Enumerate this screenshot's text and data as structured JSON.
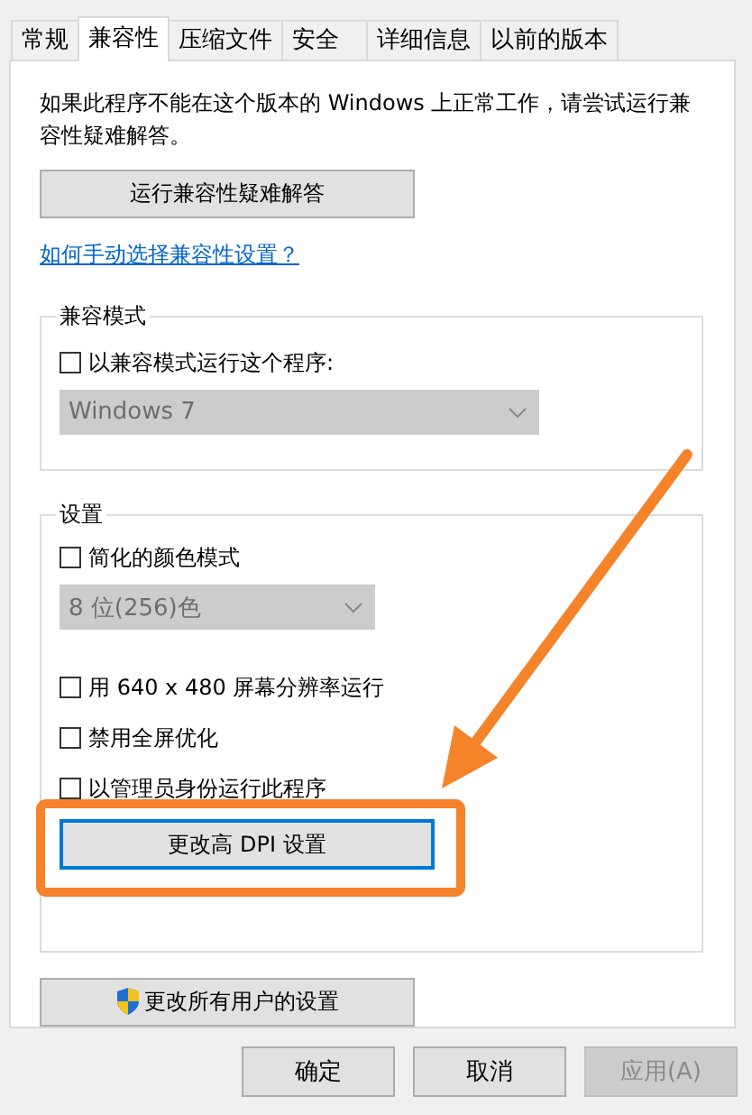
{
  "tabs": [
    {
      "label": "常规",
      "selected": false
    },
    {
      "label": "兼容性",
      "selected": true
    },
    {
      "label": "压缩文件",
      "selected": false
    },
    {
      "label": "安全",
      "selected": false
    },
    {
      "label": "详细信息",
      "selected": false
    },
    {
      "label": "以前的版本",
      "selected": false
    }
  ],
  "intro": "如果此程序不能在这个版本的 Windows 上正常工作，请尝试运行兼容性疑难解答。",
  "troubleshoot_button": "运行兼容性疑难解答",
  "help_link": "如何手动选择兼容性设置？",
  "compat_mode": {
    "title": "兼容模式",
    "checkbox": {
      "label": "以兼容模式运行这个程序:",
      "checked": false
    },
    "dropdown": {
      "value": "Windows 7",
      "disabled": true
    }
  },
  "settings": {
    "title": "设置",
    "items": [
      {
        "kind": "checkbox",
        "label": "简化的颜色模式",
        "checked": false
      },
      {
        "kind": "dropdown",
        "value": "8 位(256)色",
        "disabled": true
      },
      {
        "kind": "checkbox",
        "label": "用 640 x 480 屏幕分辨率运行",
        "checked": false
      },
      {
        "kind": "checkbox",
        "label": "禁用全屏优化",
        "checked": false
      },
      {
        "kind": "checkbox",
        "label": "以管理员身份运行此程序",
        "checked": false
      },
      {
        "kind": "button",
        "label": "更改高 DPI 设置",
        "focused": true
      }
    ]
  },
  "all_users_button": "更改所有用户的设置",
  "buttons": [
    {
      "label": "确定",
      "disabled": false
    },
    {
      "label": "取消",
      "disabled": false
    },
    {
      "label": "应用(A)",
      "disabled": true
    }
  ]
}
